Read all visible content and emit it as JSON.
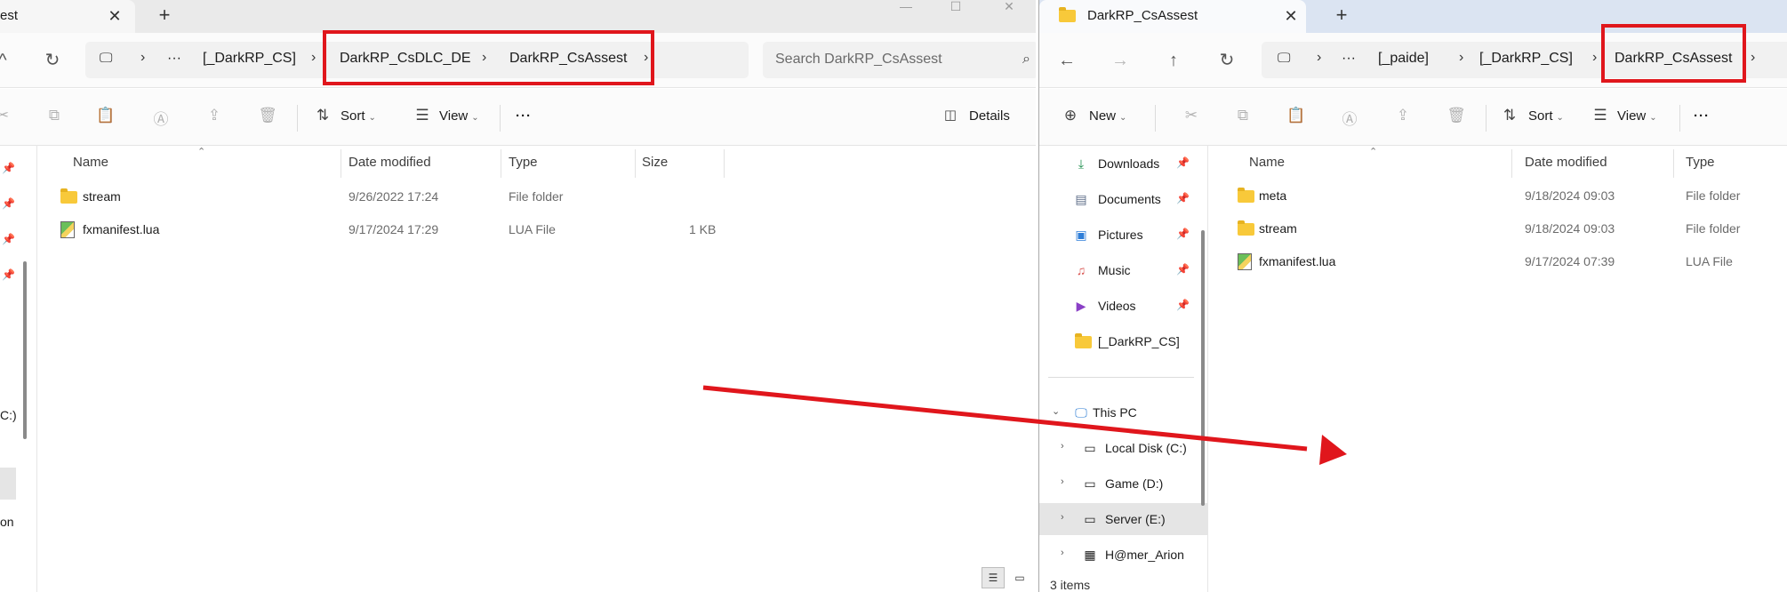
{
  "colors": {
    "annotation_red": "#e0161c",
    "folder_yellow": "#f8c93a"
  },
  "left_window": {
    "tab": {
      "title": "est",
      "close_icon": "close-icon"
    },
    "new_tab_icon": "plus-icon",
    "window_controls": {
      "minimize": "—",
      "maximize": "☐",
      "close": "✕"
    },
    "nav": {
      "back_fragment": "^",
      "refresh": "↻"
    },
    "breadcrumb": {
      "pc_icon": "computer-icon",
      "ellipsis": "···",
      "items": [
        "[_DarkRP_CS]",
        "DarkRP_CsDLC_DE",
        "DarkRP_CsAssest"
      ],
      "trailing_chevron": "›"
    },
    "search": {
      "placeholder": "Search DarkRP_CsAssest"
    },
    "toolbar": {
      "sort_label": "Sort",
      "view_label": "View",
      "more_label": "···",
      "details_label": "Details"
    },
    "columns": {
      "name": "Name",
      "date_modified": "Date modified",
      "type": "Type",
      "size": "Size"
    },
    "files": [
      {
        "name": "stream",
        "date": "9/26/2022 17:24",
        "type": "File folder",
        "size": "",
        "kind": "folder"
      },
      {
        "name": "fxmanifest.lua",
        "date": "9/17/2024 17:29",
        "type": "LUA File",
        "size": "1 KB",
        "kind": "lua"
      }
    ],
    "nav_pane_fragments": {
      "drive_c": "C:)",
      "item_on": "on"
    }
  },
  "right_window": {
    "tab": {
      "title": "DarkRP_CsAssest",
      "close_icon": "close-icon"
    },
    "new_tab_icon": "plus-icon",
    "nav": {
      "back": "←",
      "forward": "→",
      "up": "↑",
      "refresh": "↻"
    },
    "breadcrumb": {
      "pc_icon": "computer-icon",
      "ellipsis": "···",
      "items": [
        "[_paide]",
        "[_DarkRP_CS]",
        "DarkRP_CsAssest"
      ],
      "trailing_chevron": "›"
    },
    "toolbar": {
      "new_label": "New",
      "sort_label": "Sort",
      "view_label": "View",
      "more_label": "···"
    },
    "quick_access": [
      {
        "label": "Downloads",
        "icon": "download-icon"
      },
      {
        "label": "Documents",
        "icon": "document-icon"
      },
      {
        "label": "Pictures",
        "icon": "pictures-icon"
      },
      {
        "label": "Music",
        "icon": "music-icon"
      },
      {
        "label": "Videos",
        "icon": "videos-icon"
      },
      {
        "label": "[_DarkRP_CS]",
        "icon": "folder-icon"
      }
    ],
    "this_pc": {
      "label": "This PC",
      "drives": [
        {
          "label": "Local Disk (C:)",
          "selected": false
        },
        {
          "label": "Game (D:)",
          "selected": false
        },
        {
          "label": "Server (E:)",
          "selected": true
        },
        {
          "label": "H@mer_Arion",
          "selected": false
        }
      ]
    },
    "columns": {
      "name": "Name",
      "date_modified": "Date modified",
      "type": "Type"
    },
    "files": [
      {
        "name": "meta",
        "date": "9/18/2024 09:03",
        "type": "File folder",
        "kind": "folder"
      },
      {
        "name": "stream",
        "date": "9/18/2024 09:03",
        "type": "File folder",
        "kind": "folder"
      },
      {
        "name": "fxmanifest.lua",
        "date": "9/17/2024 07:39",
        "type": "LUA File",
        "kind": "lua"
      }
    ],
    "status": "3 items"
  }
}
